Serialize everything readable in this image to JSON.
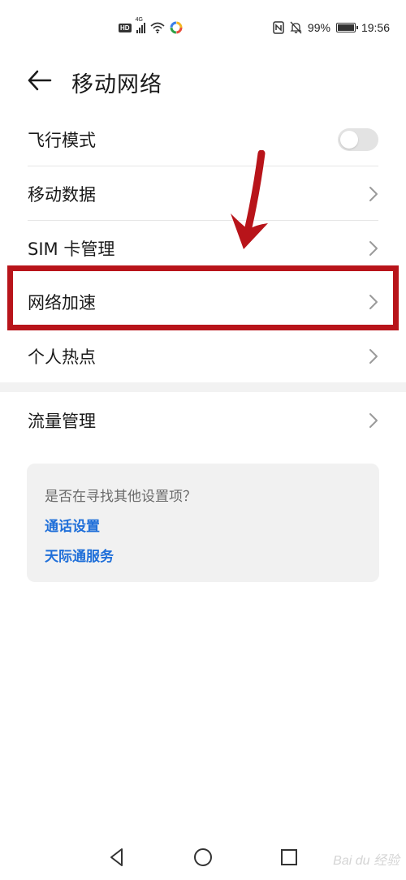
{
  "status_bar": {
    "hd": "HD",
    "network": "4G",
    "battery": "99%",
    "battery_fraction": 0.99,
    "time": "19:56",
    "icons": [
      "hd-icon",
      "signal-icon",
      "wifi-icon",
      "app-icon",
      "nfc-icon",
      "mute-icon",
      "battery-icon"
    ]
  },
  "header": {
    "title": "移动网络"
  },
  "list": {
    "items": [
      {
        "label": "飞行模式",
        "control": "toggle",
        "toggle_on": false
      },
      {
        "label": "移动数据",
        "control": "chevron"
      },
      {
        "label": "SIM 卡管理",
        "control": "chevron"
      },
      {
        "label": "网络加速",
        "control": "chevron",
        "highlighted": true
      },
      {
        "label": "个人热点",
        "control": "chevron"
      },
      {
        "label": "流量管理",
        "control": "chevron"
      }
    ]
  },
  "suggestions": {
    "question": "是否在寻找其他设置项？",
    "links": [
      "通话设置",
      "天际通服务"
    ]
  },
  "watermark": "Bai du 经验",
  "colors": {
    "accent_link": "#1f6fd9",
    "annotation_red": "#b8141a",
    "toggle_off": "#e3e3e3"
  }
}
